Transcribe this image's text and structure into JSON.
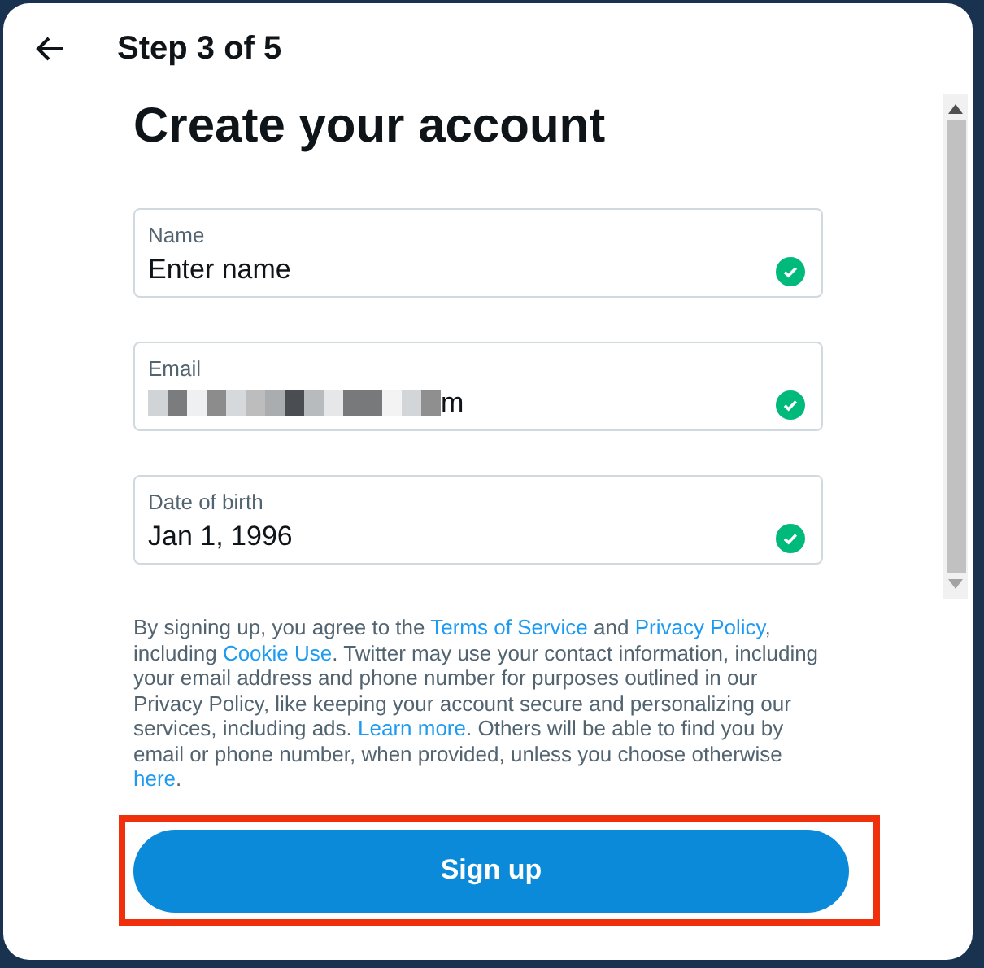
{
  "header": {
    "step": "Step 3 of 5"
  },
  "title": "Create your account",
  "fields": [
    {
      "label": "Name",
      "value": "Enter name",
      "redacted": false,
      "valid": true
    },
    {
      "label": "Email",
      "value": "m",
      "redacted": true,
      "valid": true
    },
    {
      "label": "Date of birth",
      "value": "Jan 1, 1996",
      "redacted": false,
      "valid": true
    }
  ],
  "notice": [
    {
      "text": "By signing up, you agree to the ",
      "link": false
    },
    {
      "text": "Terms of Service",
      "link": true
    },
    {
      "text": " and ",
      "link": false
    },
    {
      "text": "Privacy Policy",
      "link": true
    },
    {
      "text": ", including ",
      "link": false
    },
    {
      "text": "Cookie Use",
      "link": true
    },
    {
      "text": ". Twitter may use your contact information, including your email address and phone number for purposes outlined in our Privacy Policy, like keeping your account secure and personalizing our services, including ads. ",
      "link": false
    },
    {
      "text": "Learn more",
      "link": true
    },
    {
      "text": ". Others will be able to find you by email or phone number, when provided, unless you choose otherwise ",
      "link": false
    },
    {
      "text": "here",
      "link": true
    },
    {
      "text": ".",
      "link": false
    }
  ],
  "button": {
    "label": "Sign up",
    "highlighted": true
  }
}
